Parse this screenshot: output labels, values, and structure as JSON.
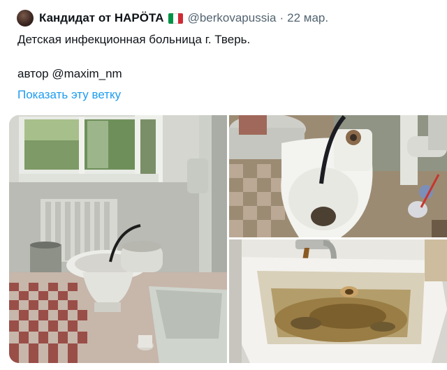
{
  "tweet": {
    "author_name": "Кандидат от НАРӦТА",
    "handle": "@berkovapussia",
    "separator": "·",
    "date": "22 мар.",
    "flag": {
      "name": "italy-flag-icon",
      "colors": [
        "#009246",
        "#ffffff",
        "#ce2b37"
      ]
    },
    "text_line1": "Детская инфекционная больница г. Тверь.",
    "text_line2": "автор @maxim_nm",
    "show_thread": "Показать эту ветку"
  },
  "colors": {
    "link": "#1d9bf0",
    "name": "#0f1419",
    "muted": "#536471"
  }
}
